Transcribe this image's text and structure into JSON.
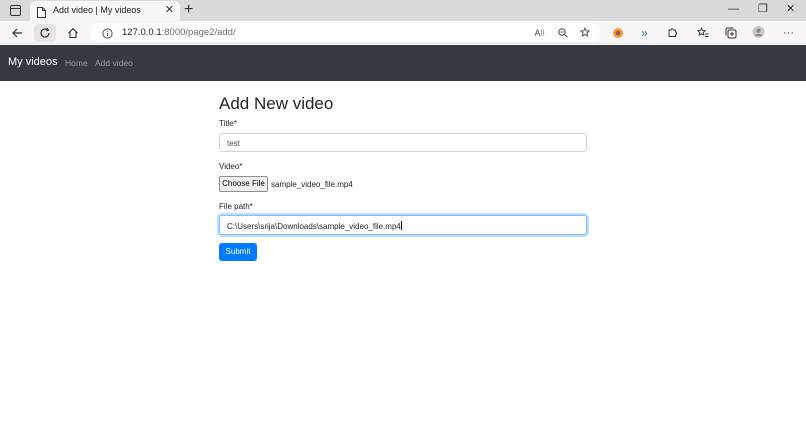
{
  "browser": {
    "tab_title": "Add video | My videos",
    "tab_close": "✕",
    "new_tab": "+",
    "url_host": "127.0.0.1",
    "url_rest": ":8000/page2/add/",
    "window_controls": {
      "minimize": "—",
      "restore": "❐",
      "close": "✕"
    },
    "more_menu": "···"
  },
  "navbar": {
    "brand": "My videos",
    "links": [
      {
        "label": "Home"
      },
      {
        "label": "Add video"
      }
    ],
    "background": "#343a40"
  },
  "form": {
    "heading": "Add New video",
    "title": {
      "label": "Title*",
      "value": "test"
    },
    "video": {
      "label": "Video*",
      "button_label": "Choose File",
      "file_name": "sample_video_file.mp4"
    },
    "file_path": {
      "label": "File path*",
      "value": "C:\\Users\\srija\\Downloads\\sample_video_file.mp4"
    },
    "submit_label": "Submit",
    "accent": "#007bff"
  }
}
